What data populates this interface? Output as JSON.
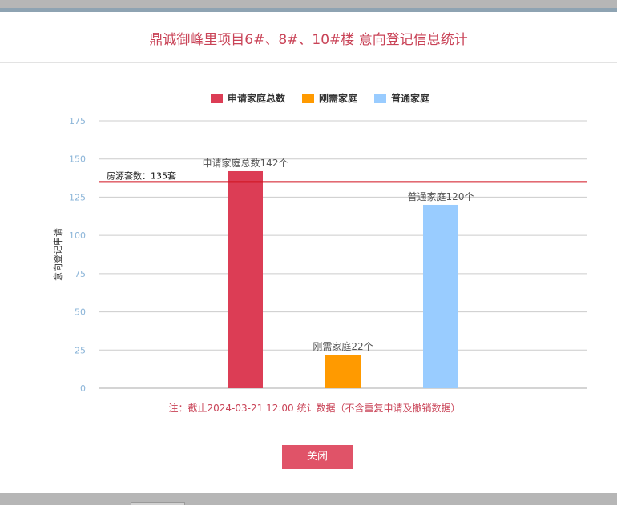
{
  "dialog": {
    "title": "鼎诚御峰里项目6#、8#、10#楼 意向登记信息统计",
    "note": "注：截止2024-03-21 12:00 统计数据（不含重复申请及撤销数据）",
    "close_label": "关闭"
  },
  "chart_data": {
    "type": "bar",
    "categories": [
      "申请家庭总数",
      "刚需家庭",
      "普通家庭"
    ],
    "series": [
      {
        "name": "申请家庭总数",
        "value": 142,
        "color": "#dc3d55",
        "data_label": "申请家庭总数142个"
      },
      {
        "name": "刚需家庭",
        "value": 22,
        "color": "#ff9a00",
        "data_label": "刚需家庭22个"
      },
      {
        "name": "普通家庭",
        "value": 120,
        "color": "#99ccff",
        "data_label": "普通家庭120个"
      }
    ],
    "ylabel": "意向登记申请",
    "ylim": [
      0,
      175
    ],
    "yticks": [
      0,
      25,
      50,
      75,
      100,
      125,
      150,
      175
    ],
    "grid": true,
    "legend": "top-center",
    "reference_line": {
      "value": 135,
      "label": "房源套数：135套",
      "color": "#d0121f"
    }
  }
}
